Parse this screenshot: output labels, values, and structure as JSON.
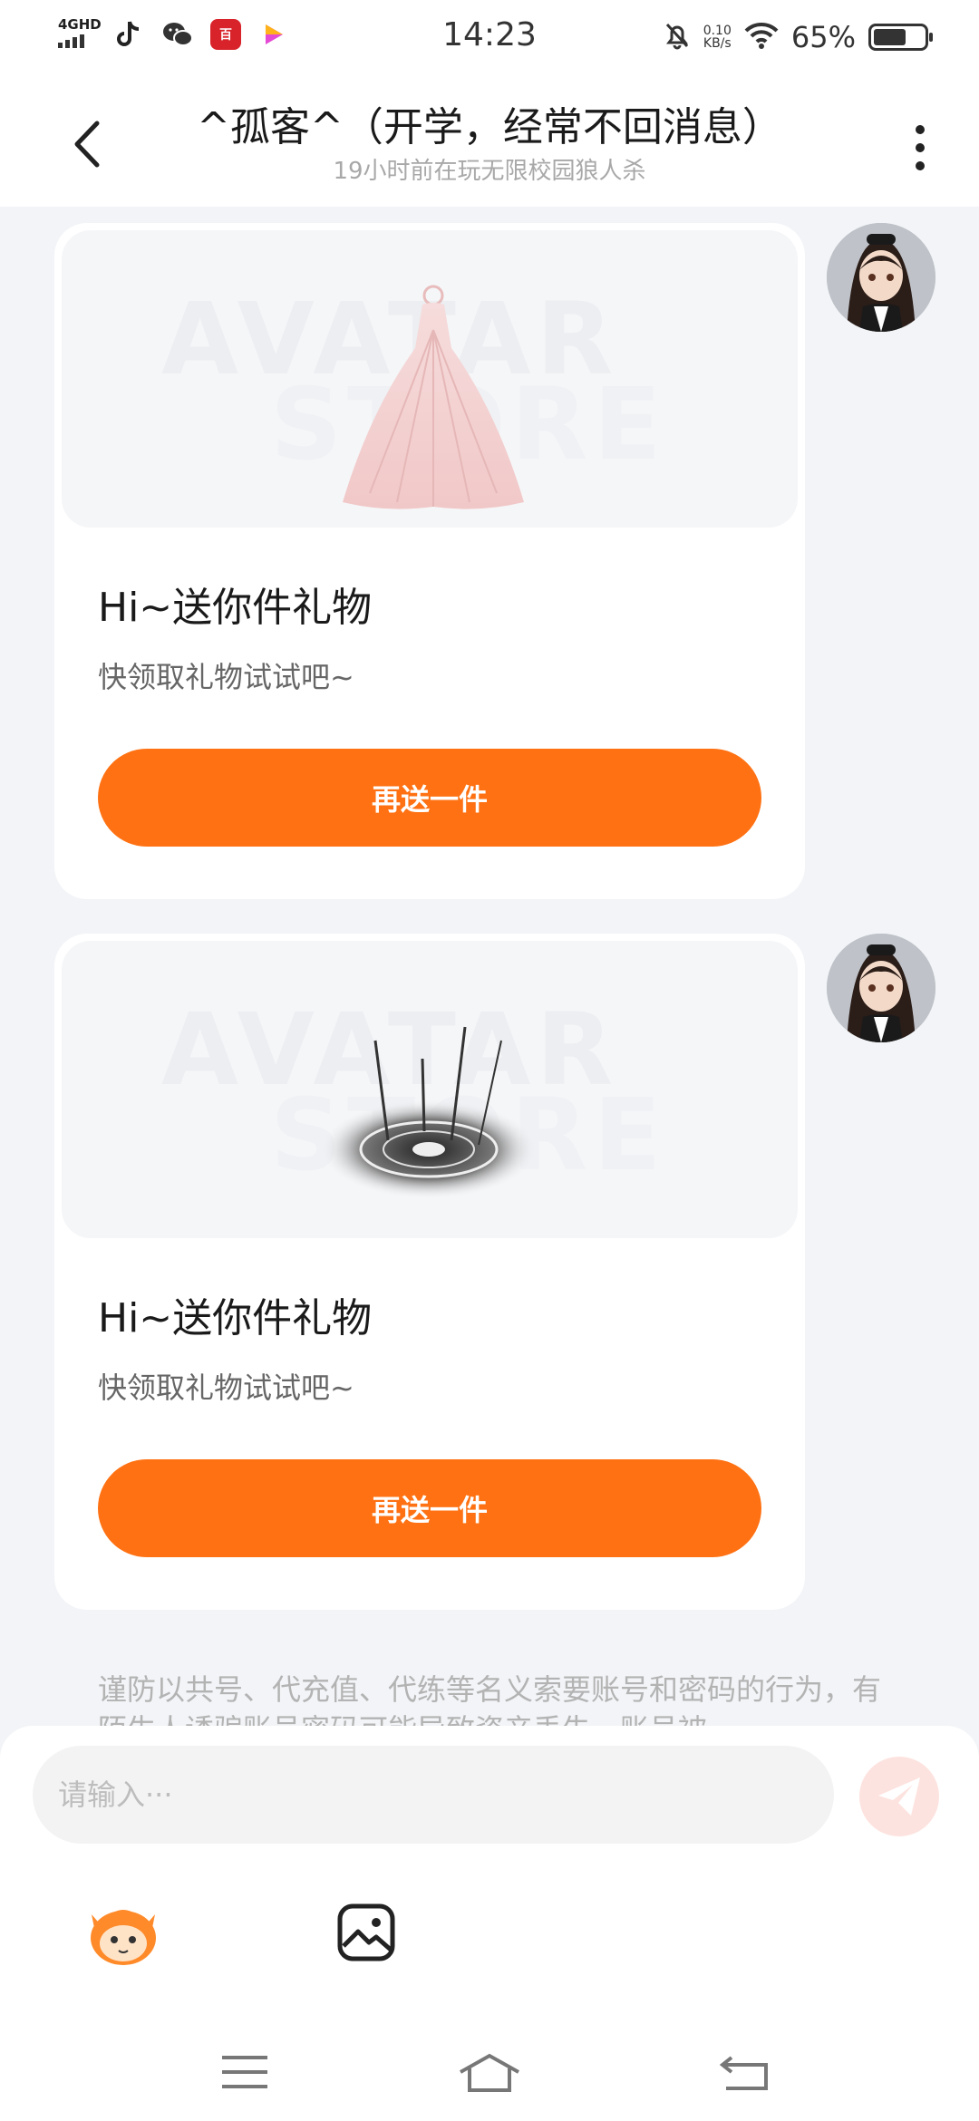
{
  "status_bar": {
    "network": "4GHD",
    "app_icons": [
      "tiktok-icon",
      "wechat-icon",
      "app-red-icon",
      "video-app-icon"
    ],
    "red_app_label": "百",
    "time": "14:23",
    "speed_value": "0.10",
    "speed_unit": "KB/s",
    "battery_percent": "65%",
    "battery_level": 0.65
  },
  "header": {
    "title": "^孤客^（开学，经常不回消息）",
    "subtitle": "19小时前在玩无限校园狼人杀"
  },
  "messages": [
    {
      "watermark_top": "AVATAR",
      "watermark_bottom": "STORE",
      "gift": "dress",
      "title": "Hi~送你件礼物",
      "subtitle": "快领取礼物试试吧~",
      "button": "再送一件"
    },
    {
      "watermark_top": "AVATAR",
      "watermark_bottom": "STORE",
      "gift": "magic-circle",
      "title": "Hi~送你件礼物",
      "subtitle": "快领取礼物试试吧~",
      "button": "再送一件"
    }
  ],
  "notice": "谨防以共号、代充值、代练等名义索要账号和密码的行为，有陌生人诱骗账号密码可能导致资产丢失，账号被",
  "composer": {
    "placeholder": "请输入···"
  },
  "colors": {
    "accent": "#ff7112",
    "background": "#f2f4f7",
    "send_button_bg": "#fde3df"
  }
}
